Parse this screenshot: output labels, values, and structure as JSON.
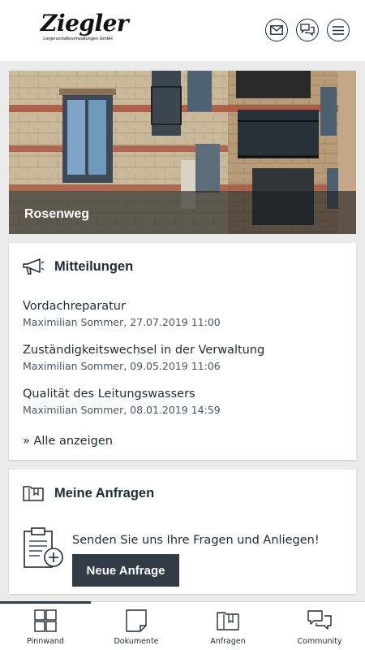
{
  "header": {
    "logo_text": "Ziegler",
    "logo_subtitle": "Liegenschaftsverwaltungen GmbH",
    "icons": [
      "mail-icon",
      "chat-icon",
      "menu-icon"
    ]
  },
  "property": {
    "name": "Rosenweg"
  },
  "messages_card": {
    "title": "Mitteilungen",
    "icon": "megaphone-icon",
    "items": [
      {
        "title": "Vordachreparatur",
        "meta": "Maximilian Sommer, 27.07.2019 11:00"
      },
      {
        "title": "Zuständigkeitswechsel in der Verwaltung",
        "meta": "Maximilian Sommer, 09.05.2019 11:06"
      },
      {
        "title": "Qualität des Leitungswassers",
        "meta": "Maximilian Sommer, 08.01.2019 14:59"
      }
    ],
    "show_all": "» Alle anzeigen"
  },
  "requests_card": {
    "title": "Meine Anfragen",
    "icon": "folder-icon",
    "prompt": "Senden Sie uns Ihre Fragen und Anliegen!",
    "button_label": "Neue Anfrage"
  },
  "tabs": [
    {
      "label": "Pinnwand",
      "icon": "grid-icon",
      "active": true
    },
    {
      "label": "Dokumente",
      "icon": "document-icon",
      "active": false
    },
    {
      "label": "Anfragen",
      "icon": "folder-icon",
      "active": false
    },
    {
      "label": "Community",
      "icon": "chat-icon",
      "active": false
    }
  ],
  "colors": {
    "primary_dark": "#323c46",
    "background": "#ebebeb",
    "text": "#1f2a33"
  }
}
